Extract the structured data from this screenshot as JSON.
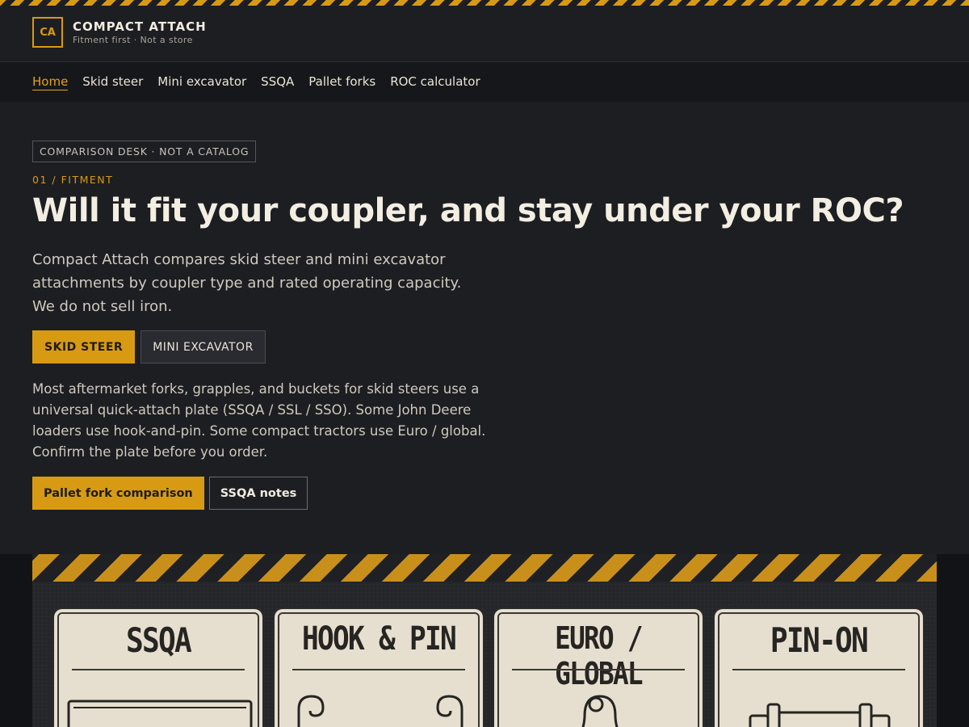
{
  "brand": {
    "logo": "CA",
    "name": "COMPACT ATTACH",
    "tagline": "Fitment first · Not a store"
  },
  "nav": {
    "items": [
      {
        "label": "Home",
        "active": true
      },
      {
        "label": "Skid steer"
      },
      {
        "label": "Mini excavator"
      },
      {
        "label": "SSQA"
      },
      {
        "label": "Pallet forks"
      },
      {
        "label": "ROC calculator"
      }
    ]
  },
  "hero": {
    "badge": "COMPARISON DESK · NOT A CATALOG",
    "section_label": "01 / FITMENT",
    "headline": "Will it fit your coupler, and stay under your ROC?",
    "lede": "Compact Attach compares skid steer and mini excavator attachments by coupler type and rated operating capacity. We do not sell iron.",
    "toggle": {
      "selected": "SKID STEER",
      "other": "MINI EXCAVATOR"
    },
    "body": "Most aftermarket forks, grapples, and buckets for skid steers use a universal quick-attach plate (SSQA / SSL / SSO). Some John Deere loaders use hook-and-pin. Some compact tractors use Euro / global. Confirm the plate before you order.",
    "cta_primary": "Pallet fork comparison",
    "cta_secondary": "SSQA notes"
  },
  "couplers": {
    "cards": [
      {
        "title": "SSQA",
        "icon": "ssqa-plate-icon"
      },
      {
        "title": "HOOK & PIN",
        "icon": "hook-and-pin-icon"
      },
      {
        "title": "EURO / GLOBAL",
        "icon": "euro-global-mount-icon"
      },
      {
        "title": "PIN-ON",
        "icon": "pin-on-icon"
      }
    ]
  },
  "colors": {
    "accent": "#d89a12",
    "background": "#1d1e22",
    "card": "#e6dfcf"
  }
}
